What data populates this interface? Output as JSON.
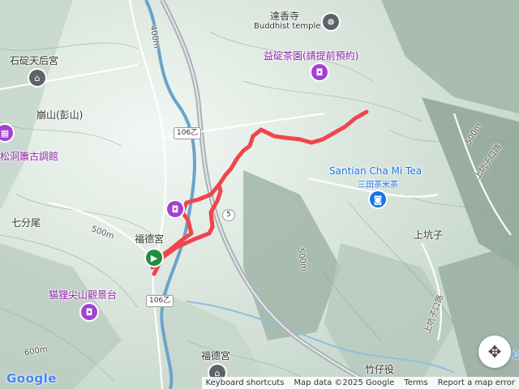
{
  "colors": {
    "route": "#f0454a",
    "terrain_light": "#e9f1ea",
    "terrain_dark": "#a7b9ad",
    "river": "#6ba3c9",
    "poi_purple": "#a142d0",
    "poi_gray": "#5f6368",
    "poi_blue": "#1a73e8",
    "start_marker": "#1e8e3e"
  },
  "labels": {
    "temple_top": "達香寺",
    "temple_top_sub": "Buddhist temple",
    "tea_garden": "益碇茶園(請提前預約)",
    "shiding_tianhou": "石碇天后宮",
    "bengshan": "崩山(彭山)",
    "songdong": "松洞簫古調館",
    "qifenwei": "七分尾",
    "fudegong_1": "福德宮",
    "maoli_lookout": "猫狸尖山觀景台",
    "fudegong_2": "福德宮",
    "santian_en": "Santian Cha Mi Tea",
    "santian_zh": "三田茶米茶",
    "shangkengzi": "上坑子",
    "zhuziyi": "竹仔役",
    "road_shangkengzi_1": "上坑子口路",
    "road_shangkengzi_2": "上坑子口路",
    "cut_right": "心"
  },
  "contours": {
    "c400": "400m",
    "c500_left": "500m",
    "c500_mid": "500m",
    "c600": "600m",
    "c500_right": "500m"
  },
  "roads": {
    "shield_106_top": "106乙",
    "shield_106_bottom": "106乙",
    "shield_5": "5"
  },
  "icons": {
    "temple": "dharma-wheel-icon",
    "tea_garden": "camera-icon",
    "shiding": "temple-icon",
    "songdong": "museum-icon",
    "maoli": "camera-icon",
    "fudegong_poi": "camera-icon",
    "fudegong_2": "temple-icon",
    "santian": "shopping-bag-icon",
    "start": "play-flag-icon"
  },
  "footer": {
    "google": "Google",
    "keyboard": "Keyboard shortcuts",
    "mapdata": "Map data ©2025 Google",
    "terms": "Terms",
    "report": "Report a map error"
  }
}
